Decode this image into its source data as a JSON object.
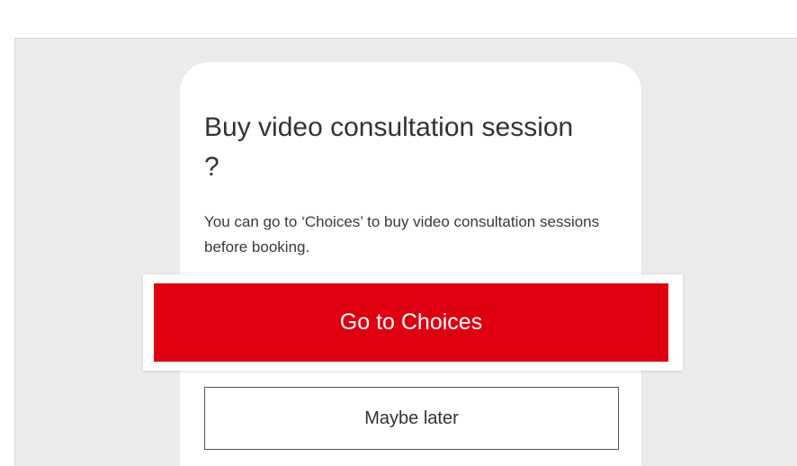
{
  "dialog": {
    "title": "Buy video consultation session ?",
    "body": "You can go to ‘Choices’ to buy video consultation sessions before booking.",
    "primary_label": "Go to Choices",
    "secondary_label": "Maybe later"
  },
  "colors": {
    "primary": "#de0010",
    "backdrop": "#ececec"
  }
}
